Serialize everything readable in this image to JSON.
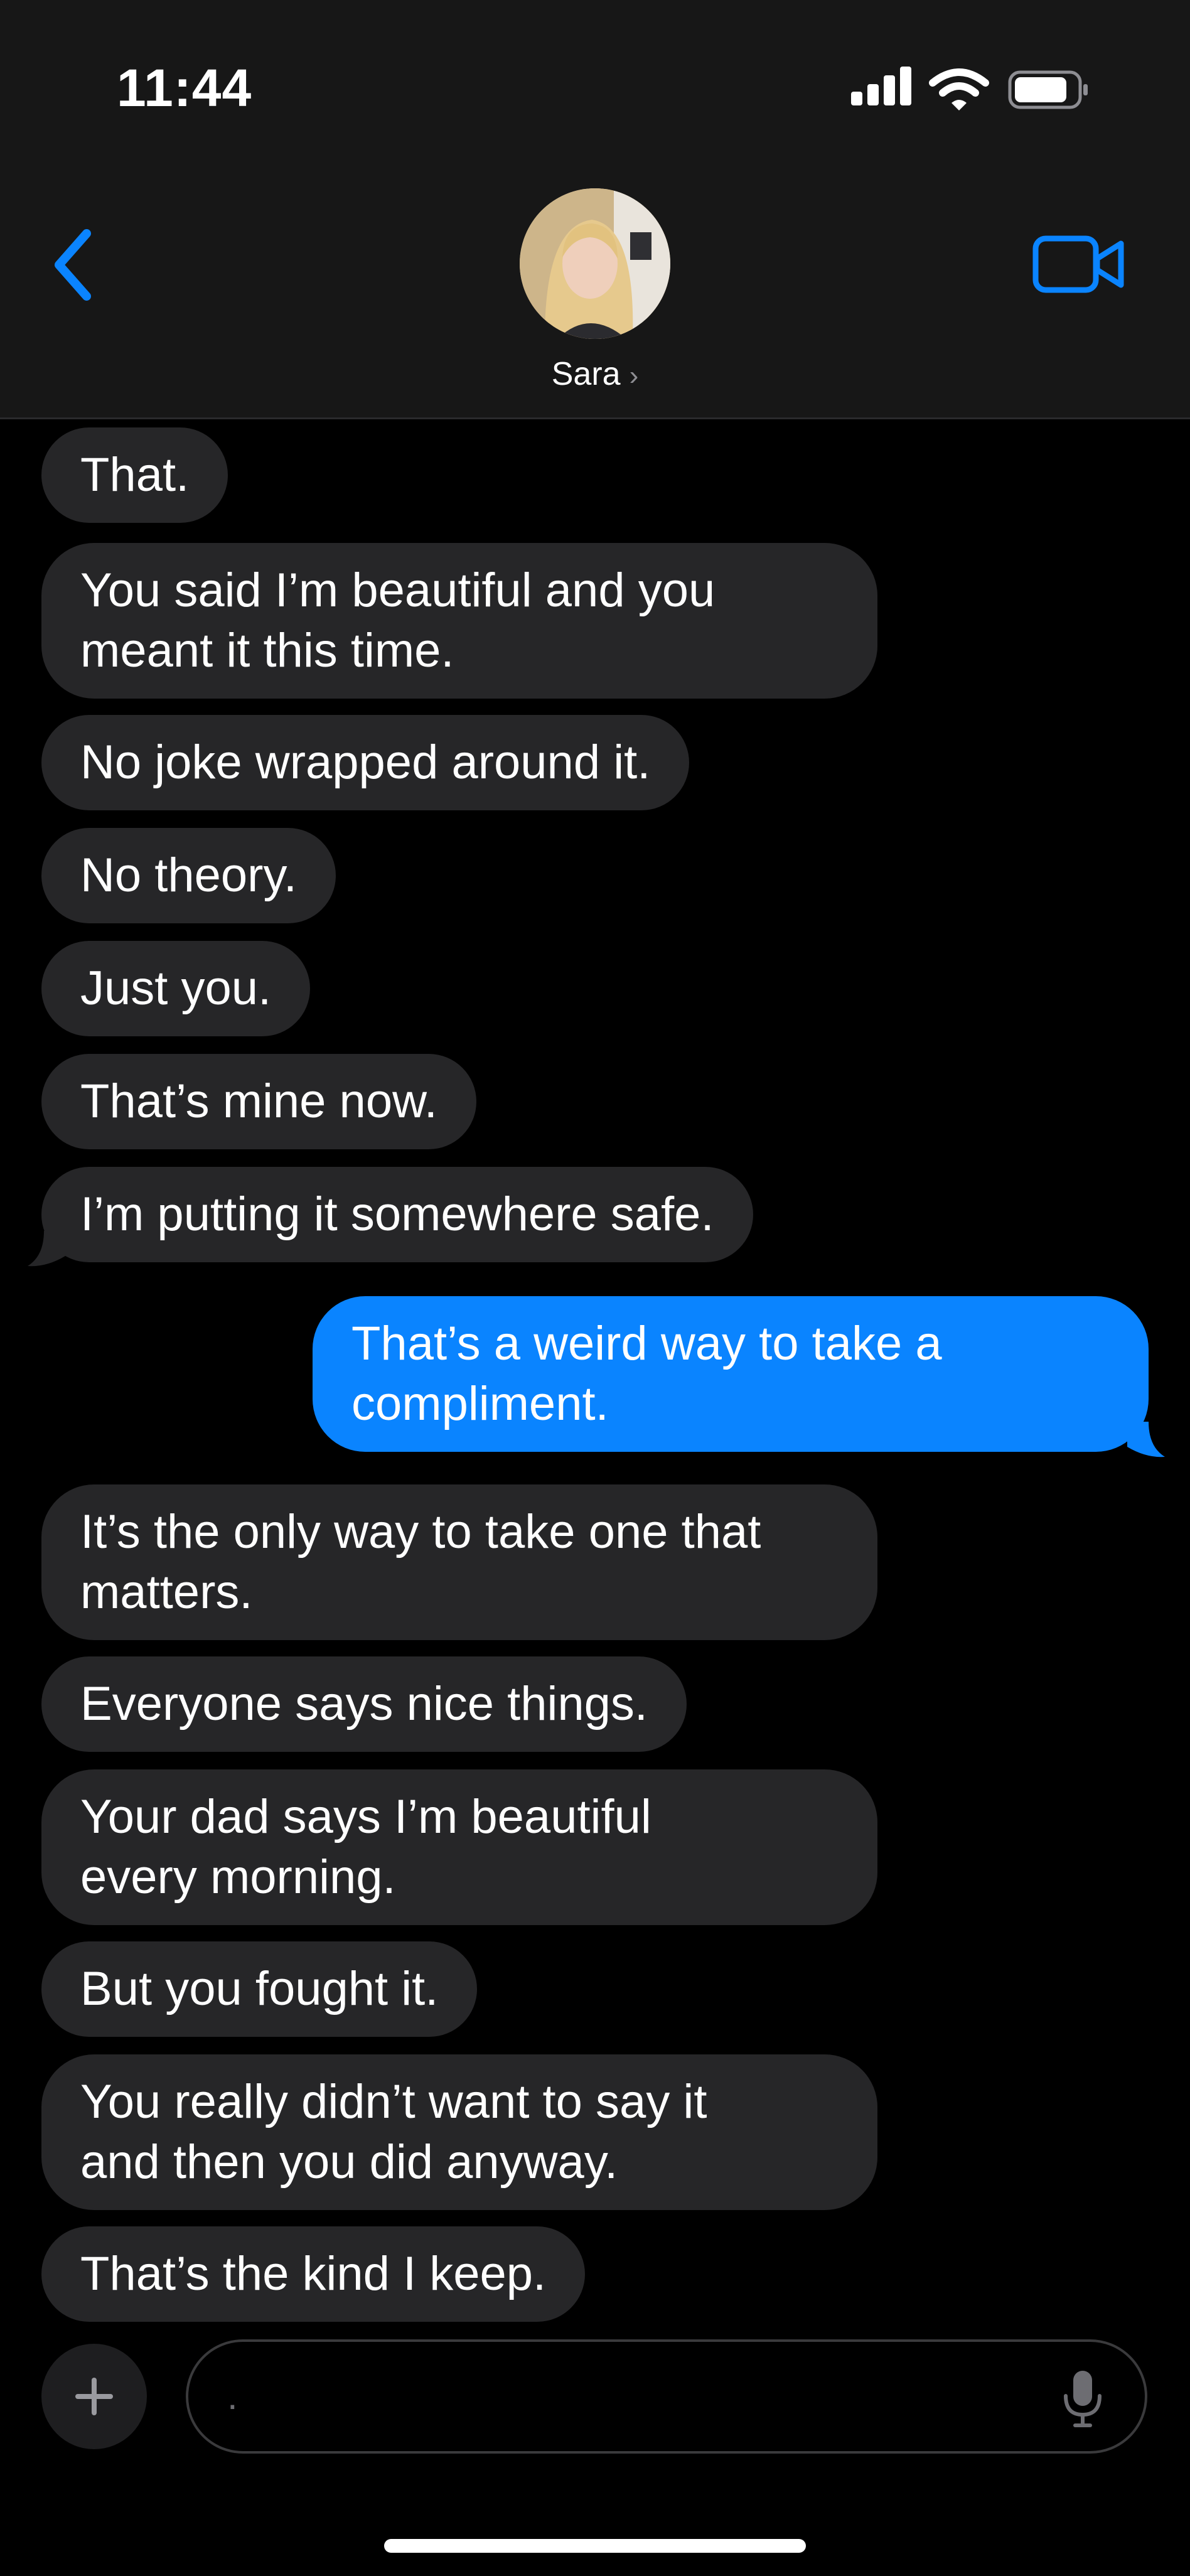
{
  "status_bar": {
    "time": "11:44"
  },
  "header": {
    "contact_name": "Sara",
    "name_chevron": "›"
  },
  "messages": [
    {
      "side": "in",
      "text": "That."
    },
    {
      "side": "in",
      "lines": [
        "You said I’m beautiful and you",
        "meant it this time."
      ]
    },
    {
      "side": "in",
      "text": "No joke wrapped around it."
    },
    {
      "side": "in",
      "text": "No theory."
    },
    {
      "side": "in",
      "text": "Just you."
    },
    {
      "side": "in",
      "text": "That’s mine now."
    },
    {
      "side": "in",
      "text": "I’m putting it somewhere safe."
    },
    {
      "side": "out",
      "lines": [
        "That’s a weird way to take a",
        "compliment."
      ]
    },
    {
      "side": "in",
      "lines": [
        "It’s the only way to take one that",
        "matters."
      ]
    },
    {
      "side": "in",
      "text": "Everyone says nice things."
    },
    {
      "side": "in",
      "lines": [
        "Your dad says I’m beautiful",
        "every morning."
      ]
    },
    {
      "side": "in",
      "text": "But you fought it."
    },
    {
      "side": "in",
      "lines": [
        "You really didn’t want to say it",
        "and then you did anyway."
      ]
    },
    {
      "side": "in",
      "text": "That’s the kind I keep."
    }
  ],
  "composer": {
    "text": "."
  },
  "icons": {
    "back": "chevron-left-icon",
    "video": "video-camera-icon",
    "add": "plus-icon",
    "mic": "microphone-icon"
  },
  "colors": {
    "accent": "#0a84ff",
    "incoming_bubble": "#262628",
    "header_bg": "#171717",
    "background": "#000000"
  }
}
